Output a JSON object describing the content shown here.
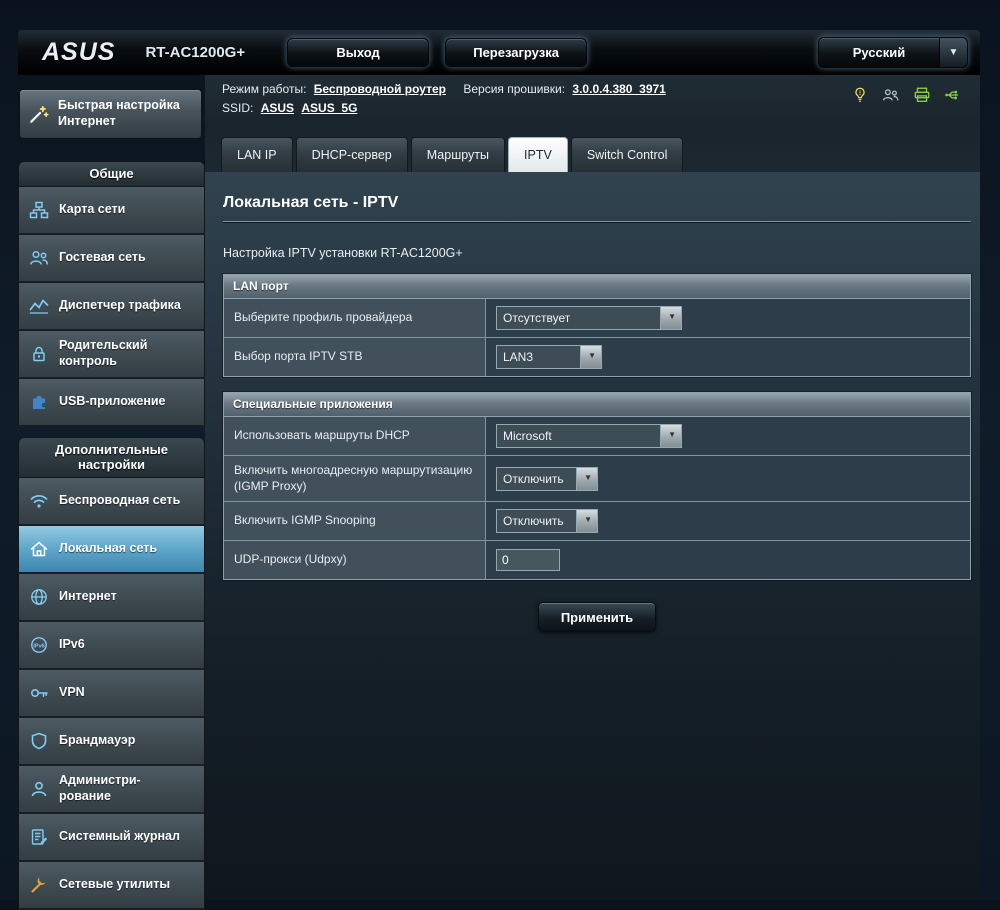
{
  "app": {
    "brand": "ASUS",
    "model": "RT-AC1200G+",
    "logout_label": "Выход",
    "reboot_label": "Перезагрузка",
    "language": "Русский"
  },
  "icons": {
    "chevron_down": "▼"
  },
  "colors": {
    "sidebar_icon_accent": "#7ecdf2",
    "selected_item_blue": "#5ea6cb",
    "status_green": "#86d13c",
    "alert_yellow": "#f6e049"
  },
  "info": {
    "mode_label": "Режим работы:",
    "mode_value": "Беспроводной роутер",
    "fw_label": "Версия прошивки:",
    "fw_value": "3.0.0.4.380_3971",
    "ssid_label": "SSID:",
    "ssid_2g": "ASUS",
    "ssid_5g": "ASUS_5G"
  },
  "sidebar": {
    "quick_setup": "Быстрая настройка Интернет",
    "sections": [
      {
        "title": "Общие",
        "items": [
          {
            "name": "network-map",
            "icon": "network-map-icon",
            "label": "Карта сети"
          },
          {
            "name": "guest-network",
            "icon": "guest-network-icon",
            "label": "Гостевая сеть"
          },
          {
            "name": "traffic-manager",
            "icon": "traffic-manager-icon",
            "label": "Диспетчер трафика"
          },
          {
            "name": "parental-control",
            "icon": "parental-control-icon",
            "label": "Родительский контроль"
          },
          {
            "name": "usb-application",
            "icon": "usb-app-icon",
            "label": "USB-приложение"
          }
        ]
      },
      {
        "title": "Дополнительные настройки",
        "items": [
          {
            "name": "wireless",
            "icon": "wireless-icon",
            "label": "Беспроводная сеть"
          },
          {
            "name": "lan",
            "icon": "lan-icon",
            "label": "Локальная сеть",
            "selected": true
          },
          {
            "name": "wan",
            "icon": "internet-icon",
            "label": "Интернет"
          },
          {
            "name": "ipv6",
            "icon": "ipv6-icon",
            "label": "IPv6"
          },
          {
            "name": "vpn",
            "icon": "vpn-icon",
            "label": "VPN"
          },
          {
            "name": "firewall",
            "icon": "firewall-icon",
            "label": "Брандмауэр"
          },
          {
            "name": "administration",
            "icon": "administration-icon",
            "label": "Администри-рование"
          },
          {
            "name": "system-log",
            "icon": "system-log-icon",
            "label": "Системный журнал"
          },
          {
            "name": "network-tools",
            "icon": "network-tools-icon",
            "label": "Сетевые утилиты"
          }
        ]
      }
    ]
  },
  "tabs": [
    {
      "name": "lan-ip",
      "label": "LAN IP"
    },
    {
      "name": "dhcp-server",
      "label": "DHCP-сервер"
    },
    {
      "name": "routes",
      "label": "Маршруты"
    },
    {
      "name": "iptv",
      "label": "IPTV",
      "active": true
    },
    {
      "name": "switch-control",
      "label": "Switch Control"
    }
  ],
  "main": {
    "title": "Локальная сеть - IPTV",
    "description": "Настройка IPTV установки RT-AC1200G+",
    "sections": [
      {
        "title": "LAN порт",
        "rows": [
          {
            "name": "isp-profile-select",
            "label": "Выберите профиль провайдера",
            "control": "select",
            "value": "Отсутствует"
          },
          {
            "name": "iptv-stb-port-select",
            "label": "Выбор порта IPTV STB",
            "control": "select",
            "value": "LAN3"
          }
        ]
      },
      {
        "title": "Специальные приложения",
        "rows": [
          {
            "name": "dhcp-routes-select",
            "label": "Использовать маршруты DHCP",
            "control": "select",
            "value": "Microsoft"
          },
          {
            "name": "igmp-proxy-select",
            "label": "Включить многоадресную маршрутизацию (IGMP Proxy)",
            "control": "select",
            "value": "Отключить"
          },
          {
            "name": "igmp-snooping-select",
            "label": "Включить IGMP Snooping",
            "control": "select",
            "value": "Отключить"
          },
          {
            "name": "udp-proxy-input",
            "label": "UDP-прокси (Udpxy)",
            "control": "input",
            "value": "0"
          }
        ]
      }
    ],
    "apply_label": "Применить"
  }
}
